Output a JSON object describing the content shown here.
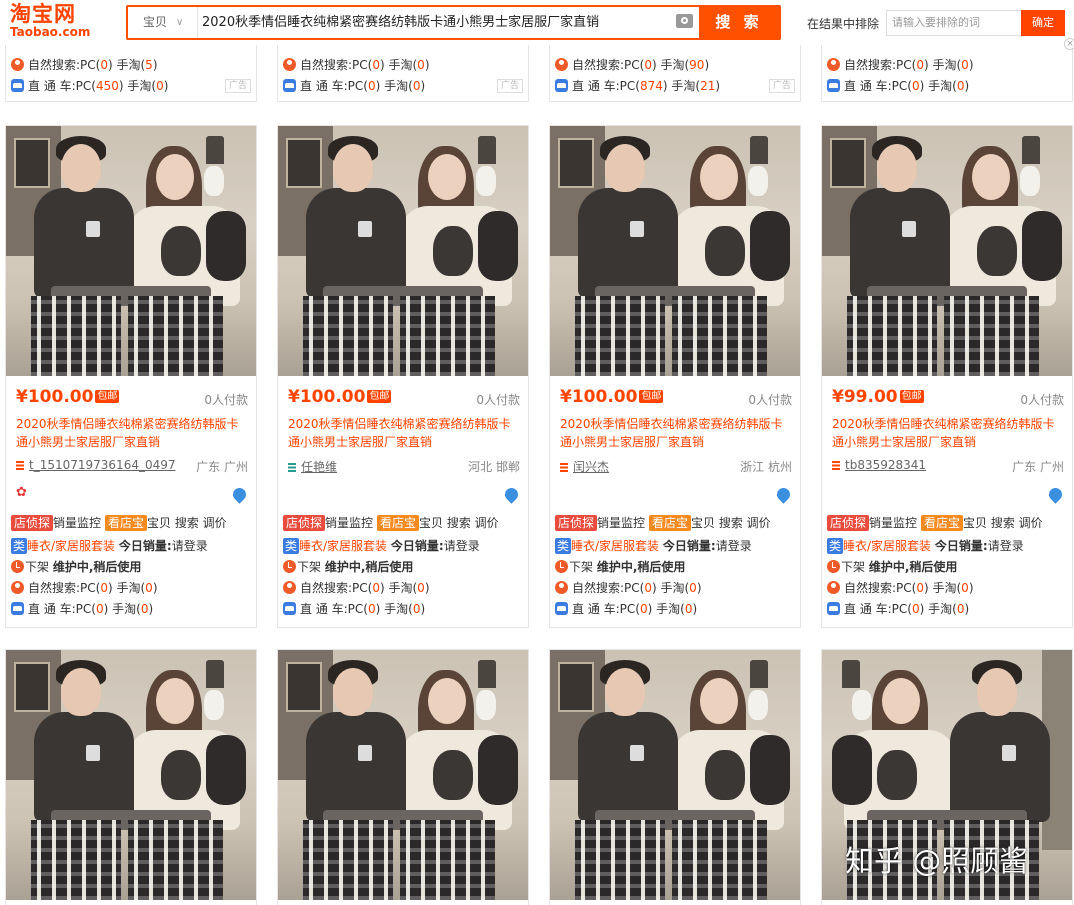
{
  "header": {
    "logo_cn": "淘宝网",
    "logo_en": "Taobao.com",
    "scope": "宝贝",
    "query": "2020秋季情侣睡衣纯棉紧密赛络纺韩版卡通小熊男士家居服厂家直销",
    "search_label": "搜 索",
    "exclude_label": "在结果中排除",
    "exclude_placeholder": "请输入要排除的词",
    "exclude_button": "确定"
  },
  "top_cards": [
    {
      "natural": [
        "自然搜索:PC(",
        "0",
        ") 手淘(",
        "5",
        ")"
      ],
      "ad": [
        "直 通 车:PC(",
        "450",
        ") 手淘(",
        "0",
        ")"
      ],
      "ad_tag": "广告"
    },
    {
      "natural": [
        "自然搜索:PC(",
        "0",
        ") 手淘(",
        "0",
        ")"
      ],
      "ad": [
        "直 通 车:PC(",
        "0",
        ") 手淘(",
        "0",
        ")"
      ],
      "ad_tag": "广告"
    },
    {
      "natural": [
        "自然搜索:PC(",
        "0",
        ") 手淘(",
        "90",
        ")"
      ],
      "ad": [
        "直 通 车:PC(",
        "874",
        ") 手淘(",
        "21",
        ")"
      ],
      "ad_tag": "广告"
    },
    {
      "natural": [
        "自然搜索:PC(",
        "0",
        ") 手淘(",
        "0",
        ")"
      ],
      "ad": [
        "直 通 车:PC(",
        "0",
        ") 手淘(",
        "0",
        ")"
      ],
      "ad_tag": ""
    }
  ],
  "products": [
    {
      "price": "¥100.00",
      "badge": "包邮",
      "buyers": "0人付款",
      "title": "2020秋季情侣睡衣纯棉紧密赛络纺韩版卡通小熊男士家居服厂家直销",
      "shop": "t_1510719736164_0497",
      "location": "广东 广州",
      "shop_icon": "orange",
      "flower": true
    },
    {
      "price": "¥100.00",
      "badge": "包邮",
      "buyers": "0人付款",
      "title": "2020秋季情侣睡衣纯棉紧密赛络纺韩版卡通小熊男士家居服厂家直销",
      "shop": "任艳维",
      "location": "河北 邯郸",
      "shop_icon": "green",
      "flower": false
    },
    {
      "price": "¥100.00",
      "badge": "包邮",
      "buyers": "0人付款",
      "title": "2020秋季情侣睡衣纯棉紧密赛络纺韩版卡通小熊男士家居服厂家直销",
      "shop": "闰兴杰",
      "location": "浙江 杭州",
      "shop_icon": "orange",
      "flower": false
    },
    {
      "price": "¥99.00",
      "badge": "包邮",
      "buyers": "0人付款",
      "title": "2020秋季情侣睡衣纯棉紧密赛络纺韩版卡通小熊男士家居服厂家直销",
      "shop": "tb835928341",
      "location": "广东 广州",
      "shop_icon": "orange",
      "flower": false
    }
  ],
  "tools": {
    "tag_detect": "店侦探",
    "sales_monitor": "销量监控",
    "tag_shop": "看店宝",
    "links": "宝贝 搜索 调价",
    "cat_tag": "类",
    "category": "睡衣/家居服套装",
    "today_sales_label": "今日销量:",
    "today_sales_value": "请登录",
    "delist_prefix": "下架",
    "delist_status": "维护中,稍后使用",
    "natural": [
      "自然搜索:PC(",
      "0",
      ") 手淘(",
      "0",
      ")"
    ],
    "ad": [
      "直 通 车:PC(",
      "0",
      ") 手淘(",
      "0",
      ")"
    ]
  },
  "watermark": "知乎 @照顾酱",
  "colors": {
    "brand": "#ff5000",
    "price": "#ff4400",
    "link_blue": "#3b7ce0"
  }
}
